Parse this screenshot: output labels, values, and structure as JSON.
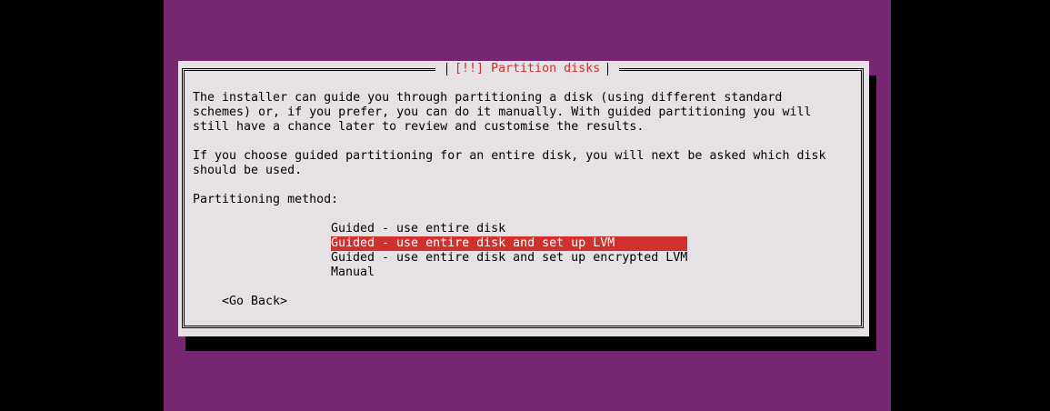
{
  "screen_bg": "#772771",
  "dialog": {
    "title": "[!!] Partition disks",
    "paragraph1": "The installer can guide you through partitioning a disk (using different standard\nschemes) or, if you prefer, you can do it manually. With guided partitioning you will\nstill have a chance later to review and customise the results.",
    "paragraph2": "If you choose guided partitioning for an entire disk, you will next be asked which disk\nshould be used.",
    "method_label": "Partitioning method:",
    "options": [
      {
        "label": "Guided - use entire disk",
        "selected": false
      },
      {
        "label": "Guided - use entire disk and set up LVM",
        "selected": true
      },
      {
        "label": "Guided - use entire disk and set up encrypted LVM",
        "selected": false
      },
      {
        "label": "Manual",
        "selected": false
      }
    ],
    "back_button": "<Go Back>"
  },
  "colors": {
    "accent": "#d0312d",
    "dialog_bg": "#e5e1e5"
  }
}
